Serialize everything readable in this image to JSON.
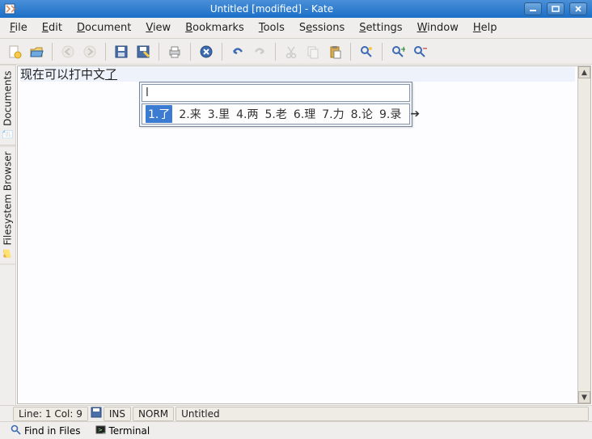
{
  "window": {
    "title": "Untitled [modified] - Kate"
  },
  "menu": {
    "file": "File",
    "edit": "Edit",
    "document": "Document",
    "view": "View",
    "bookmarks": "Bookmarks",
    "tools": "Tools",
    "sessions": "Sessions",
    "settings": "Settings",
    "window": "Window",
    "help": "Help"
  },
  "sidebar": {
    "documents": "Documents",
    "filesystem": "Filesystem Browser"
  },
  "editor": {
    "text": "现在可以打中文",
    "precomposition": "了"
  },
  "ime": {
    "input": "l",
    "candidates": [
      {
        "n": "1",
        "c": "了"
      },
      {
        "n": "2",
        "c": "来"
      },
      {
        "n": "3",
        "c": "里"
      },
      {
        "n": "4",
        "c": "两"
      },
      {
        "n": "5",
        "c": "老"
      },
      {
        "n": "6",
        "c": "理"
      },
      {
        "n": "7",
        "c": "力"
      },
      {
        "n": "8",
        "c": "论"
      },
      {
        "n": "9",
        "c": "录"
      }
    ]
  },
  "status": {
    "linecol": " Line: 1 Col: 9 ",
    "ins": "INS",
    "norm": "NORM",
    "docname": "Untitled"
  },
  "bottom": {
    "find": "Find in Files",
    "terminal": "Terminal"
  }
}
